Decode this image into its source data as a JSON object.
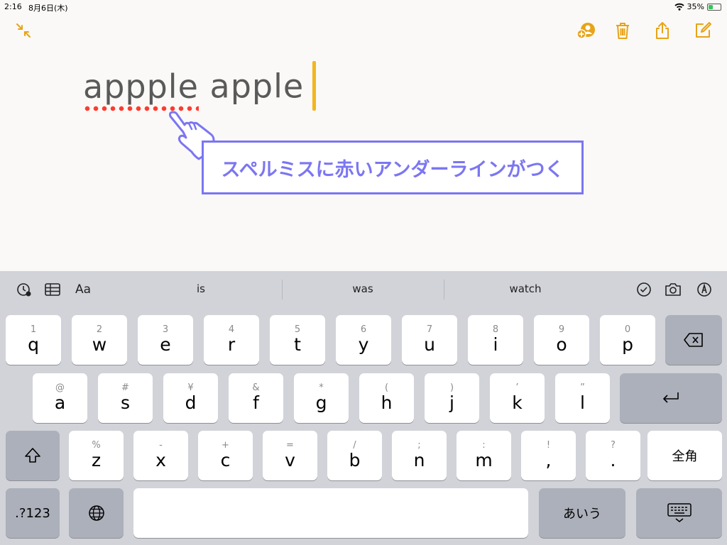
{
  "status_bar": {
    "time": "2:16",
    "date": "8月6日(木)",
    "battery": "35%",
    "battery_level": 0.35
  },
  "toolbar": {
    "collapse_icon": "collapse-arrows-icon",
    "add_person_icon": "add-person-icon",
    "trash_icon": "trash-icon",
    "share_icon": "share-icon",
    "compose_icon": "compose-icon"
  },
  "note": {
    "misspelled_word": "appple",
    "correct_word": "apple"
  },
  "callout": {
    "text": "スペルミスに赤いアンダーラインがつく"
  },
  "accent_color": "#f2b61e",
  "callout_color": "#7b76f2",
  "keyboard": {
    "predictions": [
      "is",
      "was",
      "watch"
    ],
    "format_label": "Aa",
    "row1": [
      {
        "sub": "1",
        "key": "q"
      },
      {
        "sub": "2",
        "key": "w"
      },
      {
        "sub": "3",
        "key": "e"
      },
      {
        "sub": "4",
        "key": "r"
      },
      {
        "sub": "5",
        "key": "t"
      },
      {
        "sub": "6",
        "key": "y"
      },
      {
        "sub": "7",
        "key": "u"
      },
      {
        "sub": "8",
        "key": "i"
      },
      {
        "sub": "9",
        "key": "o"
      },
      {
        "sub": "0",
        "key": "p"
      }
    ],
    "row2": [
      {
        "sub": "@",
        "key": "a"
      },
      {
        "sub": "#",
        "key": "s"
      },
      {
        "sub": "¥",
        "key": "d"
      },
      {
        "sub": "&",
        "key": "f"
      },
      {
        "sub": "*",
        "key": "g"
      },
      {
        "sub": "(",
        "key": "h"
      },
      {
        "sub": ")",
        "key": "j"
      },
      {
        "sub": "’",
        "key": "k"
      },
      {
        "sub": "”",
        "key": "l"
      }
    ],
    "row3": [
      {
        "sub": "%",
        "key": "z"
      },
      {
        "sub": "-",
        "key": "x"
      },
      {
        "sub": "+",
        "key": "c"
      },
      {
        "sub": "=",
        "key": "v"
      },
      {
        "sub": "/",
        "key": "b"
      },
      {
        "sub": ";",
        "key": "n"
      },
      {
        "sub": ":",
        "key": "m"
      },
      {
        "sub": "!",
        "key": ","
      },
      {
        "sub": "?",
        "key": "."
      }
    ],
    "fullwidth_label": "全角",
    "numbers_label": ".?123",
    "kana_label": "あいう"
  }
}
